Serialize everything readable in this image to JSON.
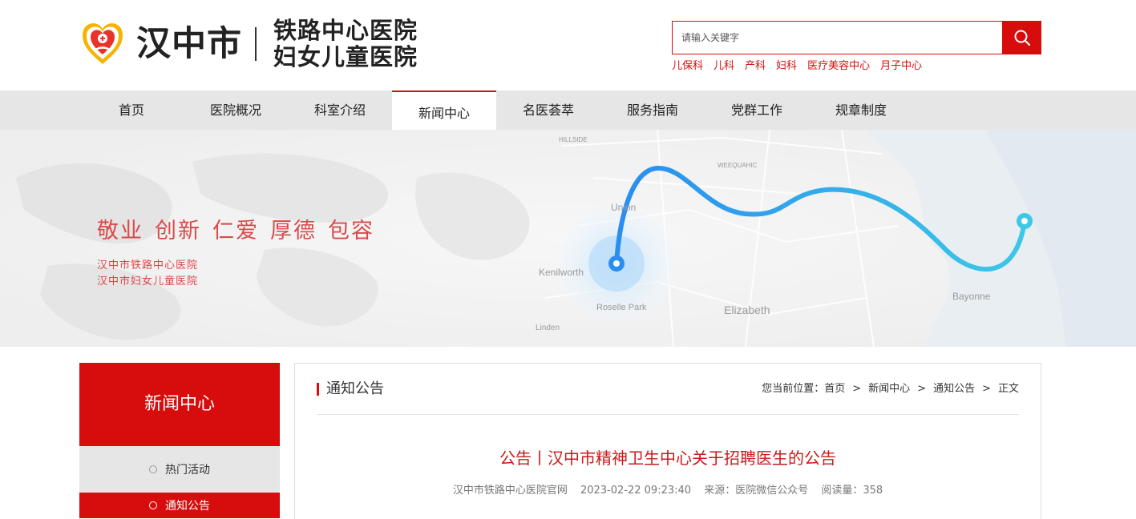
{
  "header": {
    "city_name": "汉中市",
    "hospital_line1": "铁路中心医院",
    "hospital_line2": "妇女儿童医院",
    "search_placeholder": "请输入关键字",
    "quick_links": [
      "儿保科",
      "儿科",
      "产科",
      "妇科",
      "医疗美容中心",
      "月子中心"
    ]
  },
  "nav": {
    "items": [
      "首页",
      "医院概况",
      "科室介绍",
      "新闻中心",
      "名医荟萃",
      "服务指南",
      "党群工作",
      "规章制度"
    ],
    "active": "新闻中心"
  },
  "banner": {
    "slogan": [
      "敬业",
      "创新",
      "仁爱",
      "厚德",
      "包容"
    ],
    "subtitle1": "汉中市铁路中心医院",
    "subtitle2": "汉中市妇女儿童医院",
    "map_labels": {
      "a": "Kenilworth",
      "b": "Roselle Park",
      "c": "Elizabeth",
      "d": "Bayonne",
      "e": "Union",
      "f": "WEEQUAHIC",
      "g": "HILLSIDE",
      "h": "Linden"
    }
  },
  "sidebar": {
    "title": "新闻中心",
    "items": [
      {
        "label": "热门活动",
        "active": false
      },
      {
        "label": "通知公告",
        "active": true
      }
    ]
  },
  "content": {
    "section_title": "通知公告",
    "breadcrumb_prefix": "您当前位置：",
    "breadcrumb": [
      "首页",
      "新闻中心",
      "通知公告",
      "正文"
    ],
    "breadcrumb_sep": ">",
    "article_title": "公告丨汉中市精神卫生中心关于招聘医生的公告",
    "meta": {
      "site": "汉中市铁路中心医院官网",
      "datetime": "2023-02-22 09:23:40",
      "source": "来源：医院微信公众号",
      "views": "阅读量：358"
    }
  },
  "colors": {
    "brand_red": "#d70c0c",
    "nav_bg": "#e6e6e6",
    "banner_text": "#d94a4a",
    "route_start": "#2a8ef0",
    "route_end": "#3cc8e6"
  }
}
